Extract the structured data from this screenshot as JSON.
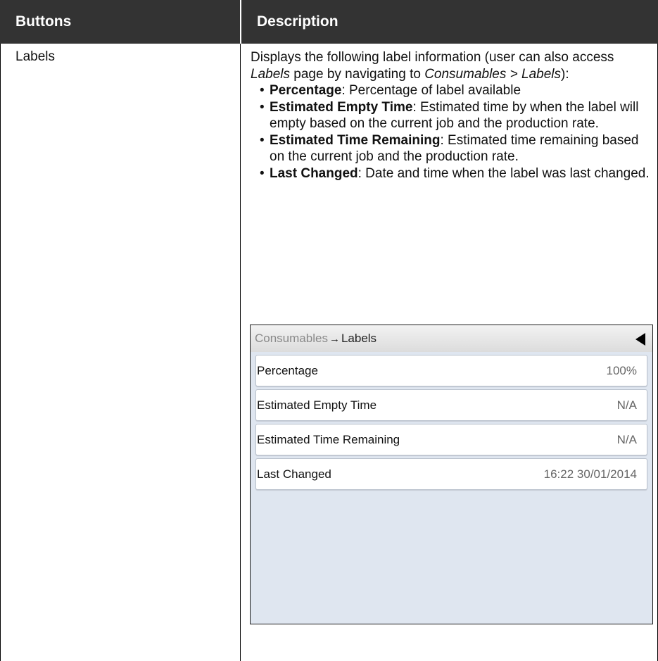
{
  "table": {
    "headers": [
      "Buttons",
      "Description"
    ],
    "row_label": "Labels",
    "description": {
      "intro_1": "Displays the following label information (user can also access ",
      "intro_italic_1": "Labels",
      "intro_2": " page by navigating to ",
      "intro_italic_2": "Consumables > Labels",
      "intro_3": "):",
      "bullets": [
        {
          "term": "Percentage",
          "text": ": Percentage of label available"
        },
        {
          "term": "Estimated Empty Time",
          "text": ": Estimated time by when the label will empty based on the current job and the production rate."
        },
        {
          "term": "Estimated Time Remaining",
          "text": ": Estimated time remaining based on the current job and the production rate."
        },
        {
          "term": "Last Changed",
          "text": ": Date and time when the label was last changed."
        }
      ]
    }
  },
  "screen": {
    "breadcrumb_root": "Consumables",
    "breadcrumb_arrow": "→",
    "breadcrumb_leaf": "Labels",
    "back_icon": "back-triangle-icon",
    "rows": [
      {
        "label": "Percentage",
        "value": "100%"
      },
      {
        "label": "Estimated Empty Time",
        "value": "N/A"
      },
      {
        "label": "Estimated Time Remaining",
        "value": "N/A"
      },
      {
        "label": "Last Changed",
        "value": "16:22 30/01/2014"
      }
    ]
  }
}
